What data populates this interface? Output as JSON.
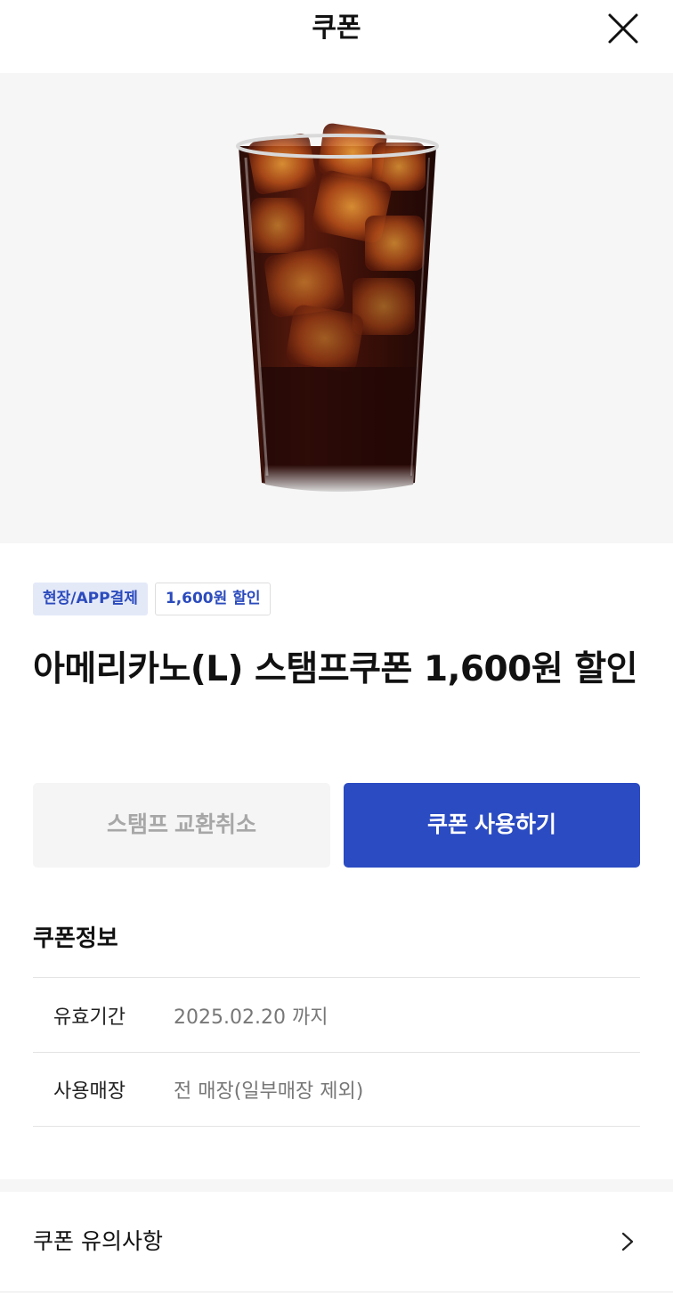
{
  "header": {
    "title": "쿠폰",
    "close_icon": "close-icon"
  },
  "hero": {
    "image": "iced-americano-glass",
    "background": "#f6f6f6"
  },
  "badges": [
    {
      "label": "현장/APP결제"
    },
    {
      "label": "1,600원 할인"
    }
  ],
  "coupon": {
    "title": "아메리카노(L) 스탬프쿠폰 1,600원 할인"
  },
  "actions": {
    "cancel_label": "스탬프 교환취소",
    "use_label": "쿠폰 사용하기",
    "accent": "#2b4bc2"
  },
  "info": {
    "heading": "쿠폰정보",
    "rows": [
      {
        "label": "유효기간",
        "value": "2025.02.20 까지"
      },
      {
        "label": "사용매장",
        "value": "전 매장(일부매장 제외)"
      }
    ]
  },
  "notice": {
    "label": "쿠폰 유의사항",
    "icon": "chevron-right-icon"
  }
}
